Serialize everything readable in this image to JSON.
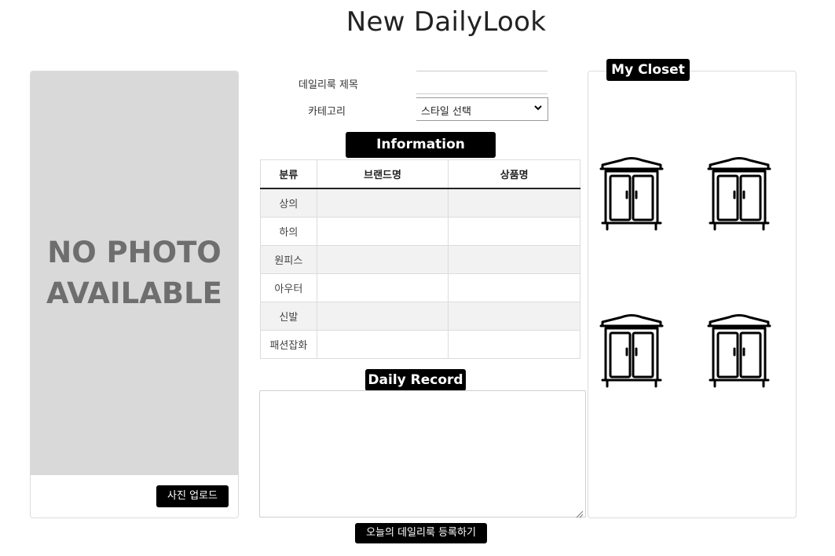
{
  "page": {
    "title": "New DailyLook"
  },
  "photo": {
    "placeholder_text": "NO PHOTO\nAVAILABLE",
    "upload_label": "사진 업로드"
  },
  "form": {
    "title_label": "데일리룩 제목",
    "title_value": "",
    "category_label": "카테고리",
    "category_selected": "스타일 선택"
  },
  "information": {
    "heading": "Information",
    "columns": [
      "분류",
      "브랜드명",
      "상품명"
    ],
    "rows": [
      {
        "category": "상의",
        "brand": "",
        "product": ""
      },
      {
        "category": "하의",
        "brand": "",
        "product": ""
      },
      {
        "category": "원피스",
        "brand": "",
        "product": ""
      },
      {
        "category": "아우터",
        "brand": "",
        "product": ""
      },
      {
        "category": "신발",
        "brand": "",
        "product": ""
      },
      {
        "category": "패션잡화",
        "brand": "",
        "product": ""
      }
    ]
  },
  "record": {
    "heading": "Daily Record",
    "value": ""
  },
  "submit_label": "오늘의 데일리룩 등록하기",
  "closet": {
    "heading": "My Closet",
    "items": [
      {
        "icon": "wardrobe-icon"
      },
      {
        "icon": "wardrobe-icon"
      },
      {
        "icon": "wardrobe-icon"
      },
      {
        "icon": "wardrobe-icon"
      }
    ]
  },
  "colors": {
    "accent": "#000000",
    "placeholder_bg": "#d9d9d9",
    "row_alt": "#f2f2f2"
  }
}
